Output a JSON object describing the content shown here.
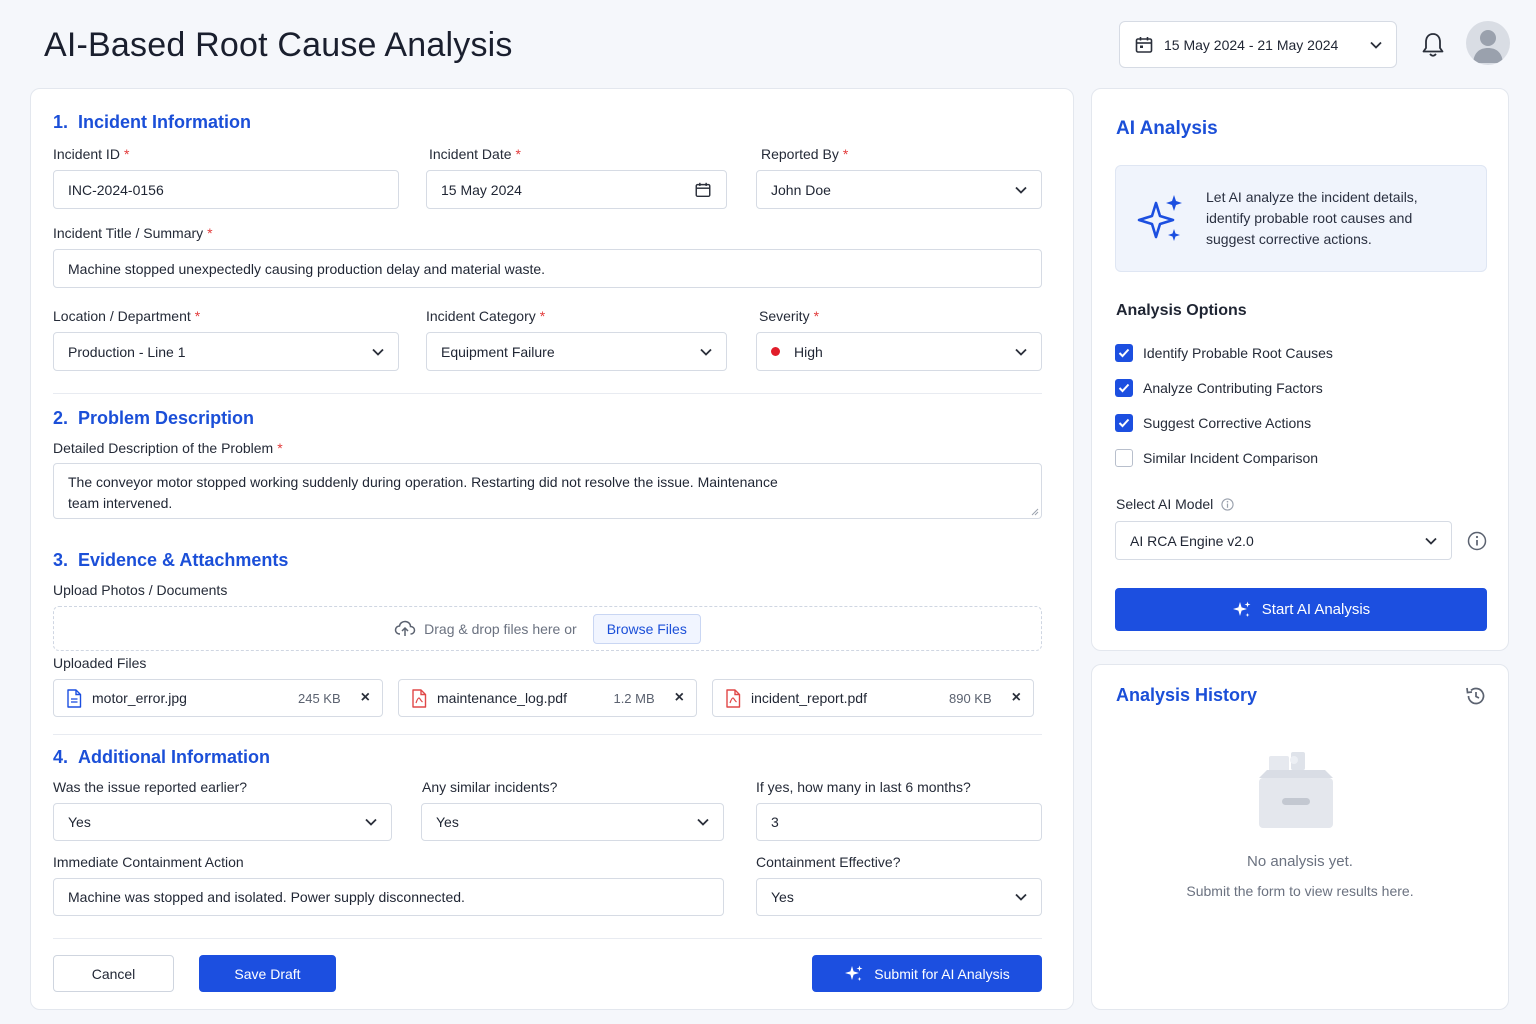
{
  "header": {
    "title": "AI-Based Root Cause Analysis",
    "date_range": "15 May 2024 - 21 May 2024"
  },
  "sections": {
    "incident": {
      "num": "1.",
      "title": "Incident Information"
    },
    "problem": {
      "num": "2.",
      "title": "Problem Description"
    },
    "evidence": {
      "num": "3.",
      "title": "Evidence & Attachments"
    },
    "additional": {
      "num": "4.",
      "title": "Additional Information"
    }
  },
  "fields": {
    "incident_id": {
      "label": "Incident ID",
      "value": "INC-2024-0156"
    },
    "incident_date": {
      "label": "Incident Date",
      "value": "15 May 2024"
    },
    "reported_by": {
      "label": "Reported By",
      "value": "John Doe"
    },
    "incident_title": {
      "label": "Incident Title / Summary",
      "value": "Machine stopped unexpectedly causing production delay and material waste."
    },
    "location": {
      "label": "Location / Department",
      "value": "Production - Line 1"
    },
    "category": {
      "label": "Incident Category",
      "value": "Equipment Failure"
    },
    "severity": {
      "label": "Severity",
      "value": "High",
      "color": "#e11d2a"
    },
    "description": {
      "label": "Detailed Description of the Problem",
      "line1": "The conveyor motor stopped working suddenly during operation. Restarting did not resolve the issue. Maintenance",
      "line2": "team intervened."
    },
    "upload": {
      "label": "Upload Photos / Documents",
      "drop_text": "Drag & drop files here or",
      "browse": "Browse Files"
    },
    "uploaded_label": "Uploaded Files",
    "reported_earlier": {
      "label": "Was the issue reported earlier?",
      "value": "Yes"
    },
    "similar": {
      "label": "Any similar incidents?",
      "value": "Yes"
    },
    "how_many": {
      "label": "If yes, how many in last 6 months?",
      "value": "3"
    },
    "containment": {
      "label": "Immediate Containment Action",
      "value": "Machine was stopped and isolated. Power supply disconnected."
    },
    "containment_effective": {
      "label": "Containment Effective?",
      "value": "Yes"
    }
  },
  "files": [
    {
      "name": "motor_error.jpg",
      "size": "245 KB",
      "icon": "image-file-icon"
    },
    {
      "name": "maintenance_log.pdf",
      "size": "1.2 MB",
      "icon": "pdf-file-icon"
    },
    {
      "name": "incident_report.pdf",
      "size": "890 KB",
      "icon": "pdf-file-icon"
    }
  ],
  "actions": {
    "cancel": "Cancel",
    "save_draft": "Save Draft",
    "submit": "Submit for AI Analysis"
  },
  "ai": {
    "title": "AI Analysis",
    "info_line1": "Let AI analyze the incident details,",
    "info_line2": "identify probable root causes and",
    "info_line3": "suggest corrective actions.",
    "options_title": "Analysis Options",
    "options": [
      {
        "label": "Identify Probable Root Causes",
        "checked": true
      },
      {
        "label": "Analyze Contributing Factors",
        "checked": true
      },
      {
        "label": "Suggest Corrective Actions",
        "checked": true
      },
      {
        "label": "Similar Incident Comparison",
        "checked": false
      }
    ],
    "model_label": "Select AI Model",
    "model_value": "AI RCA Engine v2.0",
    "start": "Start AI Analysis"
  },
  "history": {
    "title": "Analysis History",
    "empty_title": "No analysis yet.",
    "empty_sub": "Submit the form to view results here."
  },
  "colors": {
    "accent": "#1c4fe0",
    "title_blue": "#1b4fd8",
    "required": "#e23b3b",
    "pdf_red": "#e04848"
  }
}
